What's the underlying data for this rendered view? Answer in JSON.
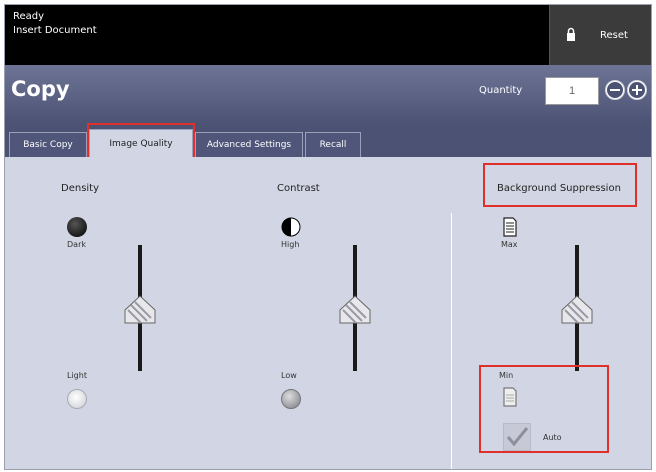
{
  "status": {
    "line1": "Ready",
    "line2": "Insert Document",
    "reset_label": "Reset"
  },
  "header": {
    "title": "Copy",
    "quantity_label": "Quantity",
    "quantity_value": "1"
  },
  "tabs": [
    {
      "label": "Basic Copy",
      "selected": false
    },
    {
      "label": "Image Quality",
      "selected": true
    },
    {
      "label": "Advanced Settings",
      "selected": false
    },
    {
      "label": "Recall",
      "selected": false
    }
  ],
  "density": {
    "title": "Density",
    "top_label": "Dark",
    "bottom_label": "Light"
  },
  "contrast": {
    "title": "Contrast",
    "top_label": "High",
    "bottom_label": "Low"
  },
  "background_suppression": {
    "title": "Background Suppression",
    "top_label": "Max",
    "bottom_label": "Min",
    "checkbox_label": "Auto"
  },
  "colors": {
    "accent": "#4b5273",
    "highlight": "#e0302c",
    "panel": "#d2d6e4"
  }
}
